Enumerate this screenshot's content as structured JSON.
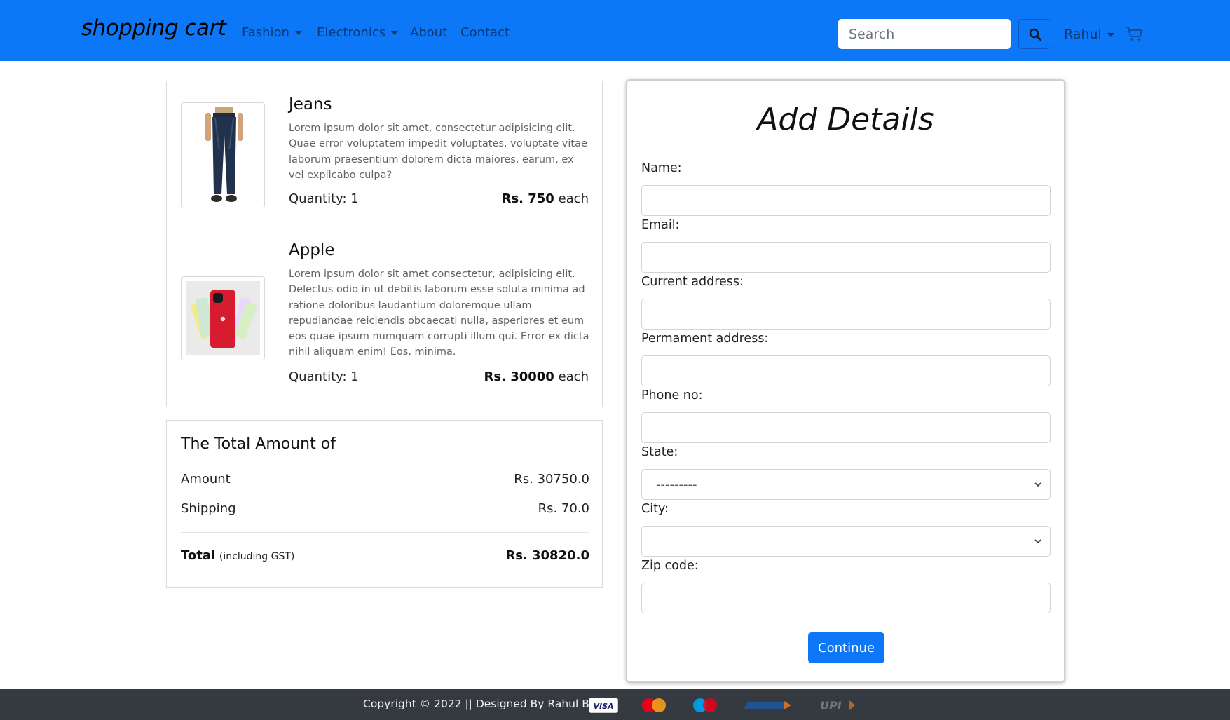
{
  "navbar": {
    "brand": "shopping cart",
    "links": [
      {
        "label": "Fashion",
        "dropdown": true
      },
      {
        "label": "Electronics",
        "dropdown": true
      },
      {
        "label": "About",
        "dropdown": false
      },
      {
        "label": "Contact",
        "dropdown": false
      }
    ],
    "search_placeholder": "Search",
    "search_icon": "search-icon",
    "user": "Rahul",
    "cart_icon": "cart-icon",
    "accent_color": "#0d78f7"
  },
  "cart": {
    "items": [
      {
        "title": "Jeans",
        "description": "Lorem ipsum dolor sit amet, consectetur adipisicing elit. Quae error voluptatem impedit voluptates, voluptate vitae laborum praesentium dolorem dicta maiores, earum, ex vel explicabo culpa?",
        "quantity": "Quantity: 1",
        "price": "Rs. 750",
        "price_suffix": "each",
        "image": "jeans-product-image"
      },
      {
        "title": "Apple",
        "description": "Lorem ipsum dolor sit amet consectetur, adipisicing elit. Delectus odio in ut debitis laborum esse soluta minima ad ratione doloribus laudantium doloremque ullam repudiandae reiciendis obcaecati nulla, asperiores et eum eos quae ipsum numquam corrupti illum qui. Error ex dicta nihil aliquam enim! Eos, minima.",
        "quantity": "Quantity: 1",
        "price": "Rs. 30000",
        "price_suffix": "each",
        "image": "iphone-product-image"
      }
    ]
  },
  "summary": {
    "title": "The Total Amount of",
    "amount_label": "Amount",
    "amount_value": "Rs. 30750.0",
    "shipping_label": "Shipping",
    "shipping_value": "Rs. 70.0",
    "total_label": "Total",
    "total_note": "(including GST)",
    "total_value": "Rs. 30820.0"
  },
  "form": {
    "title": "Add Details",
    "fields": {
      "name": "Name:",
      "email": "Email:",
      "current_address": "Current address:",
      "permanent_address": "Permament address:",
      "phone": "Phone no:",
      "state": "State:",
      "city": "City:",
      "zip": "Zip code:"
    },
    "state_selected": "---------",
    "city_selected": "",
    "continue_label": "Continue"
  },
  "footer": {
    "text": "Copyright © 2022 || Designed By Rahul Bose ||",
    "payment_icons": [
      "visa-icon",
      "mastercard-icon",
      "maestro-icon",
      "rupay-icon",
      "upi-icon"
    ],
    "visa_label": "VISA",
    "upi_label": "UPI"
  }
}
